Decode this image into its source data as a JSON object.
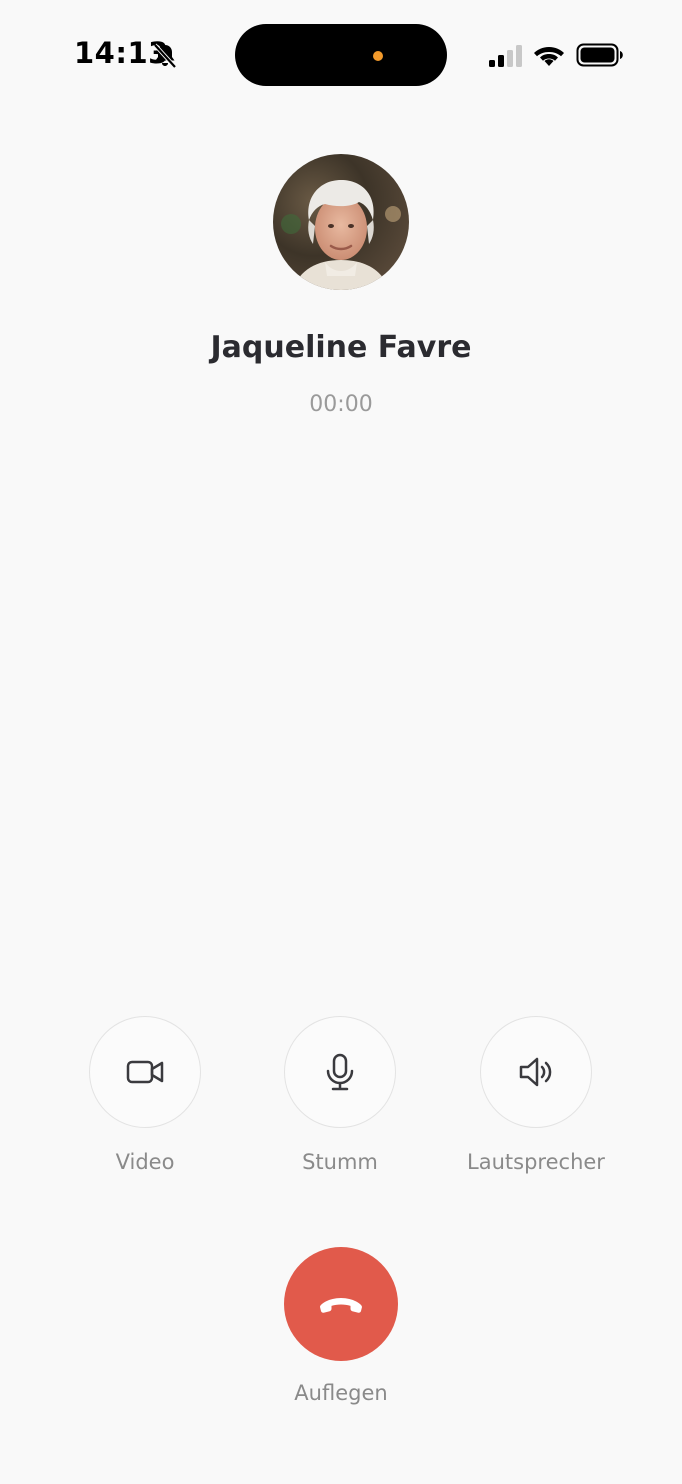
{
  "status_bar": {
    "time": "14:13",
    "icons": [
      "bell-slash-icon",
      "cellular-signal-icon",
      "wifi-icon",
      "battery-icon"
    ],
    "recording_dot_color": "#f39a2b"
  },
  "caller": {
    "name": "Jaqueline Favre",
    "duration": "00:00"
  },
  "controls": {
    "video_label": "Video",
    "mute_label": "Stumm",
    "speaker_label": "Lautsprecher"
  },
  "hangup": {
    "label": "Auflegen",
    "color": "#e15a4b"
  }
}
